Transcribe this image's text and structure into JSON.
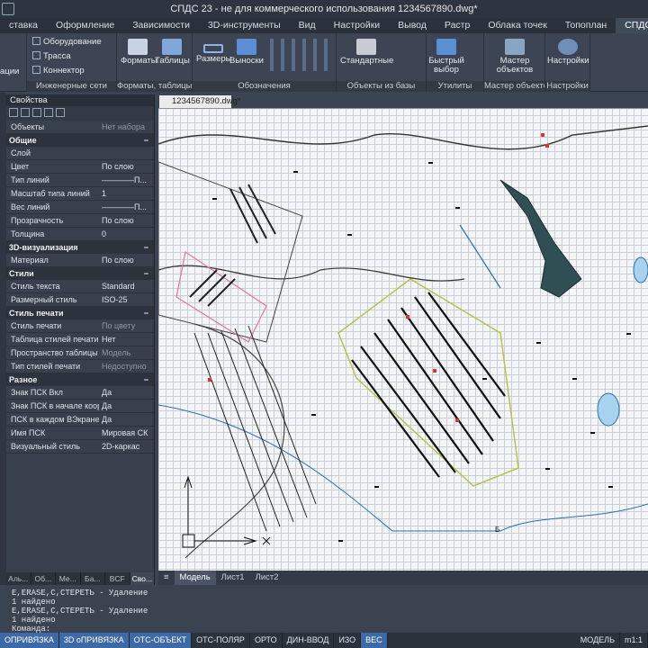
{
  "window": {
    "title": "СПДС 23 - не для коммерческого использования 1234567890.dwg*"
  },
  "ribbon_tabs": [
    "ставка",
    "Оформление",
    "Зависимости",
    "3D-инструменты",
    "Вид",
    "Настройки",
    "Вывод",
    "Растр",
    "Облака точек",
    "Топоплан",
    "СПДС"
  ],
  "active_tab": "СПДС",
  "ribbon": {
    "groups": [
      "Инженерные сети",
      "Форматы, таблицы",
      "Обозначения",
      "Объекты из базы",
      "Утилиты",
      "Мастер объектов",
      "Настройки"
    ],
    "left_label": "ации",
    "eng": [
      "Оборудование",
      "Трасса",
      "Коннектор"
    ],
    "formats": "Форматы",
    "tables": "Таблицы",
    "sizes": "Размеры",
    "leaders": "Выноски",
    "standard": "Стандартные",
    "quick": "Быстрый выбор",
    "master": "Мастер объектов",
    "settings": "Настройки"
  },
  "properties": {
    "title": "Свойства",
    "objects_label": "Объекты",
    "objects_value": "Нет набора",
    "sections": [
      {
        "name": "Общие",
        "rows": [
          [
            "Слой",
            ""
          ],
          [
            "Цвет",
            "По слою"
          ],
          [
            "Тип линий",
            "————П..."
          ],
          [
            "Масштаб типа линий",
            "1"
          ],
          [
            "Вес линий",
            "————П..."
          ],
          [
            "Прозрачность",
            "По слою"
          ],
          [
            "Толщина",
            "0"
          ]
        ]
      },
      {
        "name": "3D-визуализация",
        "rows": [
          [
            "Материал",
            "По слою"
          ]
        ]
      },
      {
        "name": "Стили",
        "rows": [
          [
            "Стиль текста",
            "Standard"
          ],
          [
            "Размерный стиль",
            "ISO-25"
          ]
        ]
      },
      {
        "name": "Стиль печати",
        "rows": [
          [
            "Стиль печати",
            "По цвету"
          ],
          [
            "Таблица стилей печати",
            "Нет"
          ],
          [
            "Пространство таблицы с...",
            "Модель"
          ],
          [
            "Тип стилей печати",
            "Недоступно"
          ]
        ]
      },
      {
        "name": "Разное",
        "rows": [
          [
            "Знак ПСК Вкл",
            "Да"
          ],
          [
            "Знак ПСК в начале коор...",
            "Да"
          ],
          [
            "ПСК в каждом ВЭкране",
            "Да"
          ],
          [
            "Имя ПСК",
            "Мировая СК"
          ],
          [
            "Визуальный стиль",
            "2D-каркас"
          ]
        ]
      }
    ],
    "bottom_tabs": [
      "Аль...",
      "Об...",
      "Ме...",
      "Ба...",
      "BCF",
      "Сво..."
    ]
  },
  "doc_tab": "1234567890.dwg*",
  "model_tabs": [
    "Модель",
    "Лист1",
    "Лист2"
  ],
  "command_lines": [
    "E,ERASE,С,СТЕРЕТЬ - Удаление",
    "1 найдено",
    "E,ERASE,С,СТЕРЕТЬ - Удаление",
    "1 найдено",
    "Команда:"
  ],
  "status": [
    "ОПРИВЯЗКА",
    "3D оПРИВЯЗКА",
    "ОТС-ОБЪЕКТ",
    "ОТС-ПОЛЯР",
    "ОРТО",
    "ДИН-ВВОД",
    "ИЗО",
    "ВЕС",
    "МОДЕЛЬ",
    "m1:1"
  ],
  "status_on": [
    "ОПРИВЯЗКА",
    "3D оПРИВЯЗКА",
    "ОТС-ОБЪЕКТ",
    "ВЕС"
  ],
  "map_label": "Б"
}
